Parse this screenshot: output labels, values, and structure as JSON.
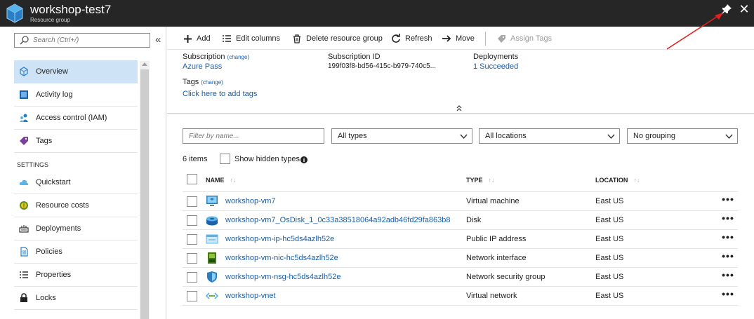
{
  "window": {
    "title": "workshop-test7",
    "subtitle": "Resource group",
    "icons": {
      "app": "resource-group-cube-icon",
      "pin": "pin-icon",
      "close": "close-icon"
    }
  },
  "colors": {
    "titlebar": "#262626",
    "link": "#1a5ea8",
    "active_nav": "#cfe3f7",
    "annotation_arrow": "#e02020"
  },
  "sidebar": {
    "search_placeholder": "Search (Ctrl+/)",
    "collapse_glyph": "«",
    "items": [
      {
        "label": "Overview",
        "icon": "overview-icon",
        "active": true
      },
      {
        "label": "Activity log",
        "icon": "activity-log-icon"
      },
      {
        "label": "Access control (IAM)",
        "icon": "people-icon"
      },
      {
        "label": "Tags",
        "icon": "tag-icon"
      }
    ],
    "section_settings": "SETTINGS",
    "settings_items": [
      {
        "label": "Quickstart",
        "icon": "cloud-icon"
      },
      {
        "label": "Resource costs",
        "icon": "coin-icon"
      },
      {
        "label": "Deployments",
        "icon": "deployments-icon"
      },
      {
        "label": "Policies",
        "icon": "policy-document-icon"
      },
      {
        "label": "Properties",
        "icon": "list-icon"
      },
      {
        "label": "Locks",
        "icon": "lock-icon"
      }
    ]
  },
  "toolbar": {
    "add": "Add",
    "edit_columns": "Edit columns",
    "delete": "Delete resource group",
    "refresh": "Refresh",
    "move": "Move",
    "assign_tags": "Assign Tags"
  },
  "essentials": {
    "subscription_label": "Subscription",
    "subscription_change": "(change)",
    "subscription_value": "Azure Pass",
    "subscription_id_label": "Subscription ID",
    "subscription_id_value": "199f03f8-bd56-415c-b979-740c5...",
    "deployments_label": "Deployments",
    "deployments_value": "1 Succeeded",
    "tags_label": "Tags",
    "tags_change": "(change)",
    "tags_link": "Click here to add tags"
  },
  "filters": {
    "name_placeholder": "Filter by name...",
    "types_value": "All types",
    "locations_value": "All locations",
    "grouping_value": "No grouping"
  },
  "list": {
    "count_text": "6 items",
    "show_hidden_label": "Show hidden types",
    "columns": {
      "name": "NAME",
      "type": "TYPE",
      "location": "LOCATION",
      "sort_glyph": "↑↓"
    },
    "more_glyph": "•••",
    "rows": [
      {
        "name": "workshop-vm7",
        "type": "Virtual machine",
        "location": "East US",
        "icon": "virtual-machine-icon"
      },
      {
        "name": "workshop-vm7_OsDisk_1_0c33a38518064a92adb46fd29fa863b8",
        "type": "Disk",
        "location": "East US",
        "icon": "disk-icon"
      },
      {
        "name": "workshop-vm-ip-hc5ds4azlh52e",
        "type": "Public IP address",
        "location": "East US",
        "icon": "public-ip-icon"
      },
      {
        "name": "workshop-vm-nic-hc5ds4azlh52e",
        "type": "Network interface",
        "location": "East US",
        "icon": "network-interface-icon"
      },
      {
        "name": "workshop-vm-nsg-hc5ds4azlh52e",
        "type": "Network security group",
        "location": "East US",
        "icon": "shield-icon"
      },
      {
        "name": "workshop-vnet",
        "type": "Virtual network",
        "location": "East US",
        "icon": "virtual-network-icon"
      }
    ]
  }
}
